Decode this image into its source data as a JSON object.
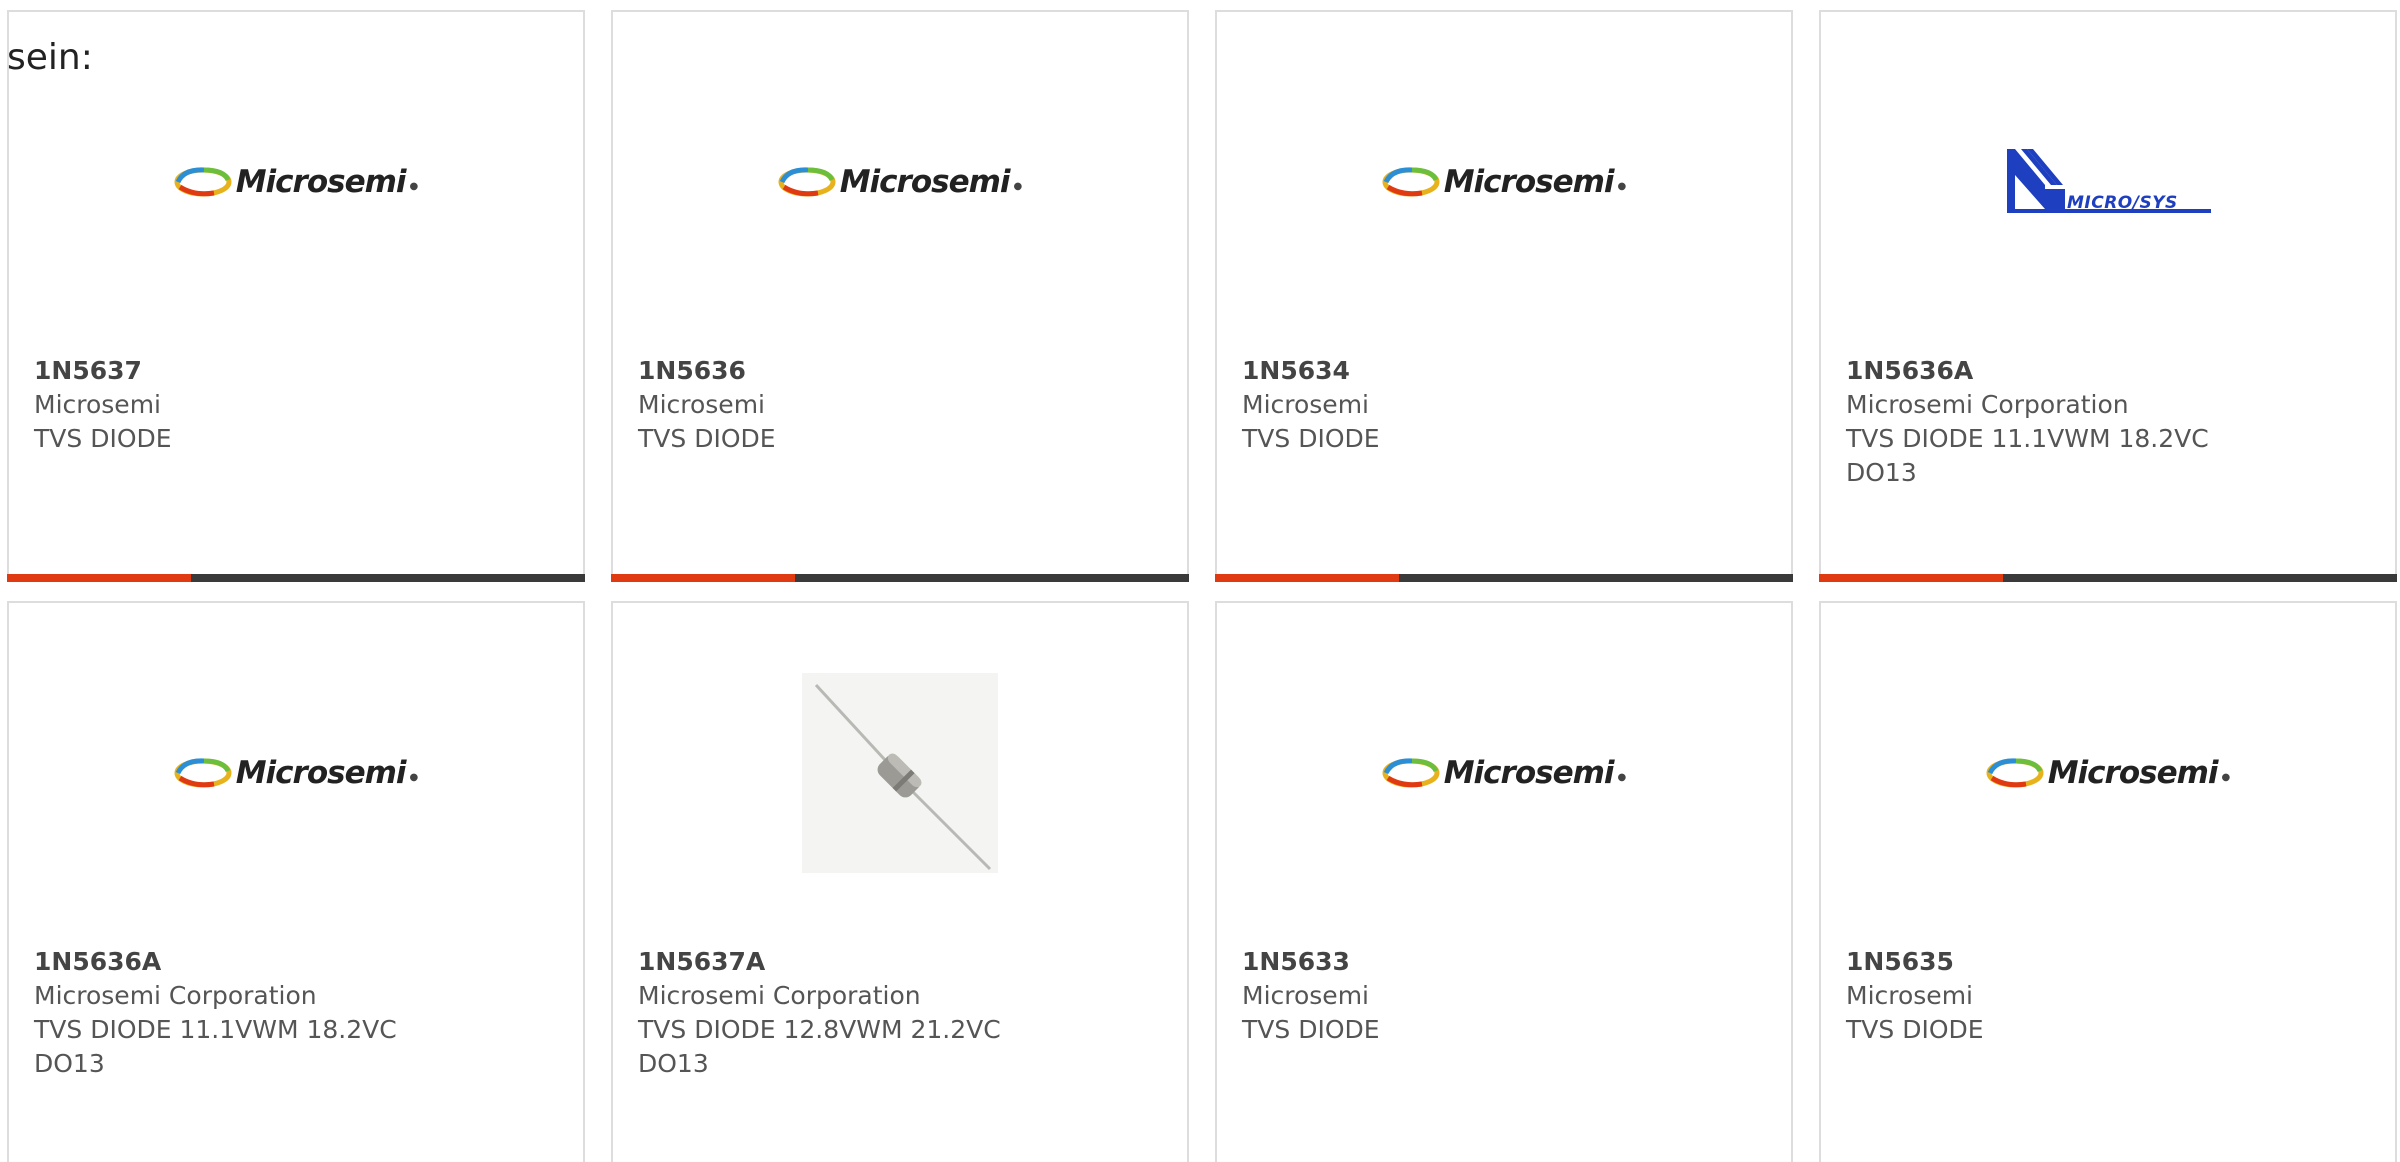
{
  "intro_text": "sein:",
  "logos": {
    "microsemi": "Microsemi",
    "microsys": "MICRO/SYS"
  },
  "colors": {
    "accent": "#e03a12",
    "bar_dark": "#3a3a3a",
    "microsys_blue": "#1e3fbf"
  },
  "cards": [
    {
      "part": "1N5637",
      "maker": "Microsemi",
      "desc1": "TVS DIODE",
      "desc2": "",
      "image": "microsemi-logo"
    },
    {
      "part": "1N5636",
      "maker": "Microsemi",
      "desc1": "TVS DIODE",
      "desc2": "",
      "image": "microsemi-logo"
    },
    {
      "part": "1N5634",
      "maker": "Microsemi",
      "desc1": "TVS DIODE",
      "desc2": "",
      "image": "microsemi-logo"
    },
    {
      "part": "1N5636A",
      "maker": "Microsemi Corporation",
      "desc1": "TVS DIODE 11.1VWM 18.2VC",
      "desc2": "DO13",
      "image": "microsys-logo"
    },
    {
      "part": "1N5636A",
      "maker": "Microsemi Corporation",
      "desc1": "TVS DIODE 11.1VWM 18.2VC",
      "desc2": "DO13",
      "image": "microsemi-logo"
    },
    {
      "part": "1N5637A",
      "maker": "Microsemi Corporation",
      "desc1": "TVS DIODE 12.8VWM 21.2VC",
      "desc2": "DO13",
      "image": "diode-photo"
    },
    {
      "part": "1N5633",
      "maker": "Microsemi",
      "desc1": "TVS DIODE",
      "desc2": "",
      "image": "microsemi-logo"
    },
    {
      "part": "1N5635",
      "maker": "Microsemi",
      "desc1": "TVS DIODE",
      "desc2": "",
      "image": "microsemi-logo"
    }
  ]
}
